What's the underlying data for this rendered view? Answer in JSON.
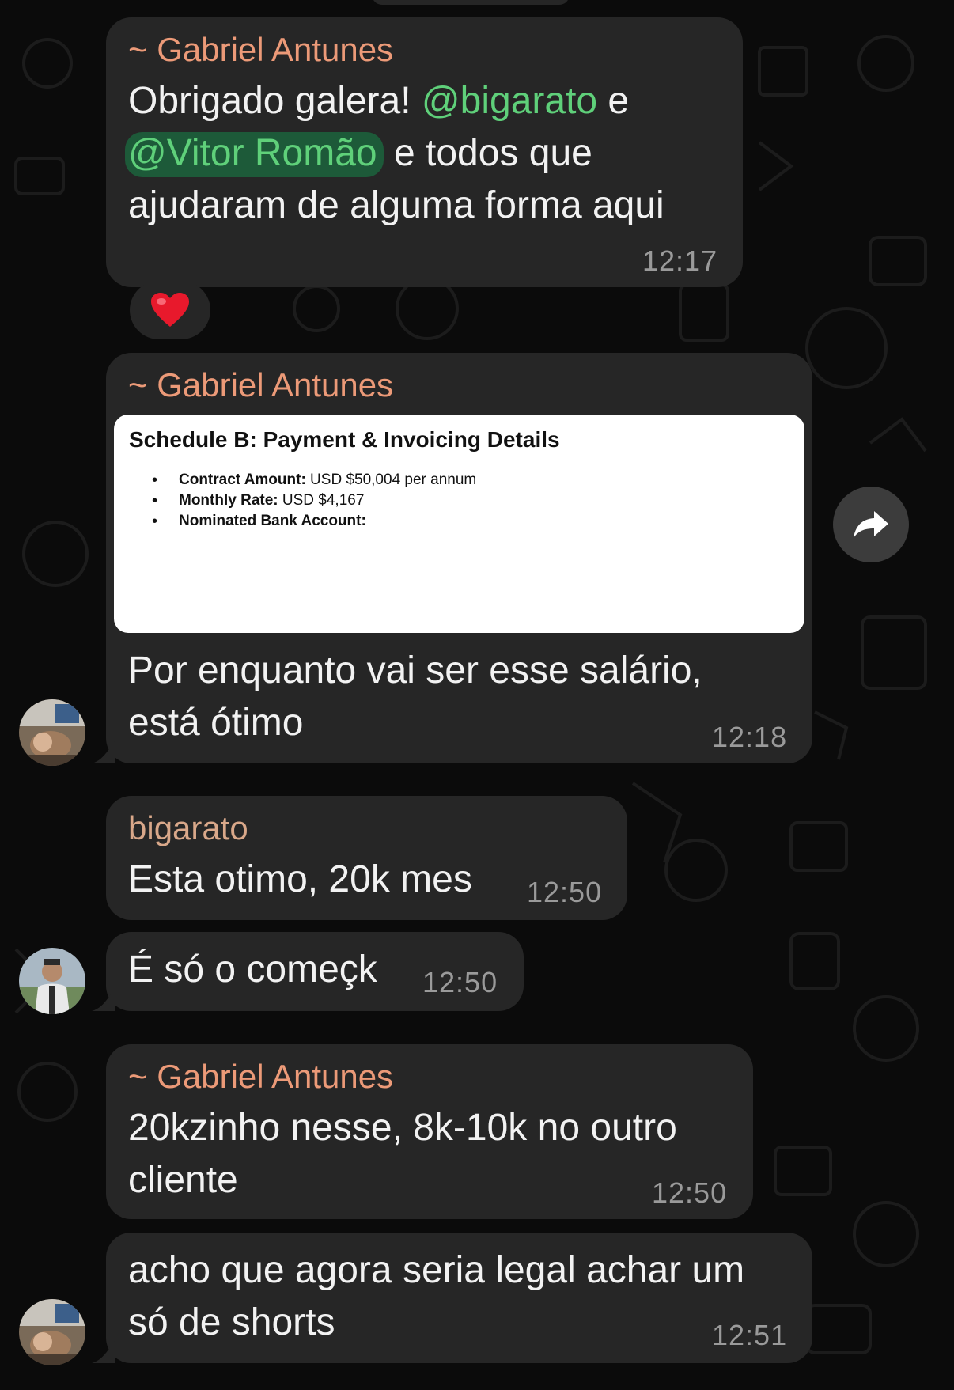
{
  "messages": [
    {
      "sender": "~ Gabriel Antunes",
      "line1_text": "Obrigado galera! ",
      "mention1": "@bigarato",
      "line1_after": " e",
      "mention2": "@Vitor Romão",
      "line2_after": " e todos que",
      "line3": "ajudaram de alguma forma aqui",
      "time": "12:17",
      "reaction": "❤️"
    },
    {
      "sender": "~ Gabriel Antunes",
      "document": {
        "title": "Schedule B: Payment & Invoicing Details",
        "items": [
          {
            "label": "Contract Amount:",
            "value": " USD $50,004 per annum"
          },
          {
            "label": "Monthly Rate:",
            "value": " USD $4,167"
          },
          {
            "label": "Nominated Bank Account:",
            "value": ""
          }
        ]
      },
      "line1": "Por enquanto vai ser esse salário,",
      "line2": "está ótimo",
      "time": "12:18"
    },
    {
      "sender": "bigarato",
      "line1": "Esta otimo, 20k mes",
      "time": "12:50"
    },
    {
      "line1": "É só o começk",
      "time": "12:50"
    },
    {
      "sender": "~ Gabriel Antunes",
      "line1": "20kzinho nesse, 8k-10k no outro",
      "line2": "cliente",
      "time": "12:50"
    },
    {
      "line1": "acho que agora seria legal achar um",
      "line2": "só de shorts",
      "time": "12:51"
    }
  ],
  "icons": {
    "forward": "forward-arrow-icon",
    "reaction": "heart-icon"
  },
  "colors": {
    "background": "#0b0b0b",
    "bubble": "#262626",
    "sender_name": "#ec9a78",
    "mention": "#5fd07a",
    "timestamp": "#9a9a9a"
  }
}
